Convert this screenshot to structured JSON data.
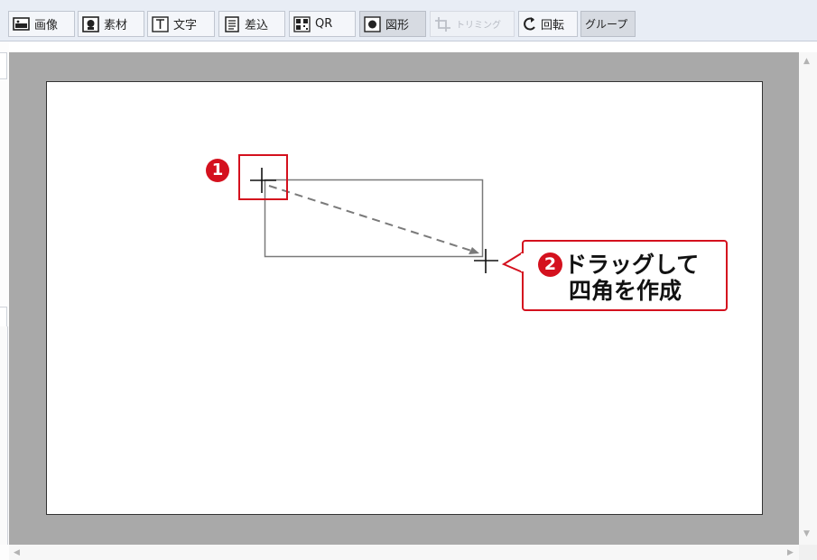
{
  "toolbar": {
    "buttons": [
      {
        "label": "画像",
        "icon": "image-icon",
        "state": "normal"
      },
      {
        "label": "素材",
        "icon": "material-icon",
        "state": "normal"
      },
      {
        "label": "文字",
        "icon": "text-icon",
        "state": "normal"
      },
      {
        "label": "差込",
        "icon": "insert-icon",
        "state": "normal"
      },
      {
        "label": "QR",
        "icon": "qr-icon",
        "state": "normal"
      },
      {
        "label": "図形",
        "icon": "shape-icon",
        "state": "active"
      },
      {
        "label": "トリミング",
        "icon": "crop-icon",
        "state": "disabled"
      },
      {
        "label": "回転",
        "icon": "rotate-icon",
        "state": "normal"
      },
      {
        "label": "グループ",
        "icon": "",
        "state": "normal"
      }
    ]
  },
  "annotations": {
    "step1_number": "1",
    "step2_number": "2",
    "callout_line1": "ドラッグして",
    "callout_line2": "四角を作成"
  },
  "colors": {
    "accent_red": "#d4111e",
    "toolbar_bg": "#e8edf5",
    "canvas_gray": "#a9a9a9",
    "drag_rect": "#7a7a7a"
  }
}
